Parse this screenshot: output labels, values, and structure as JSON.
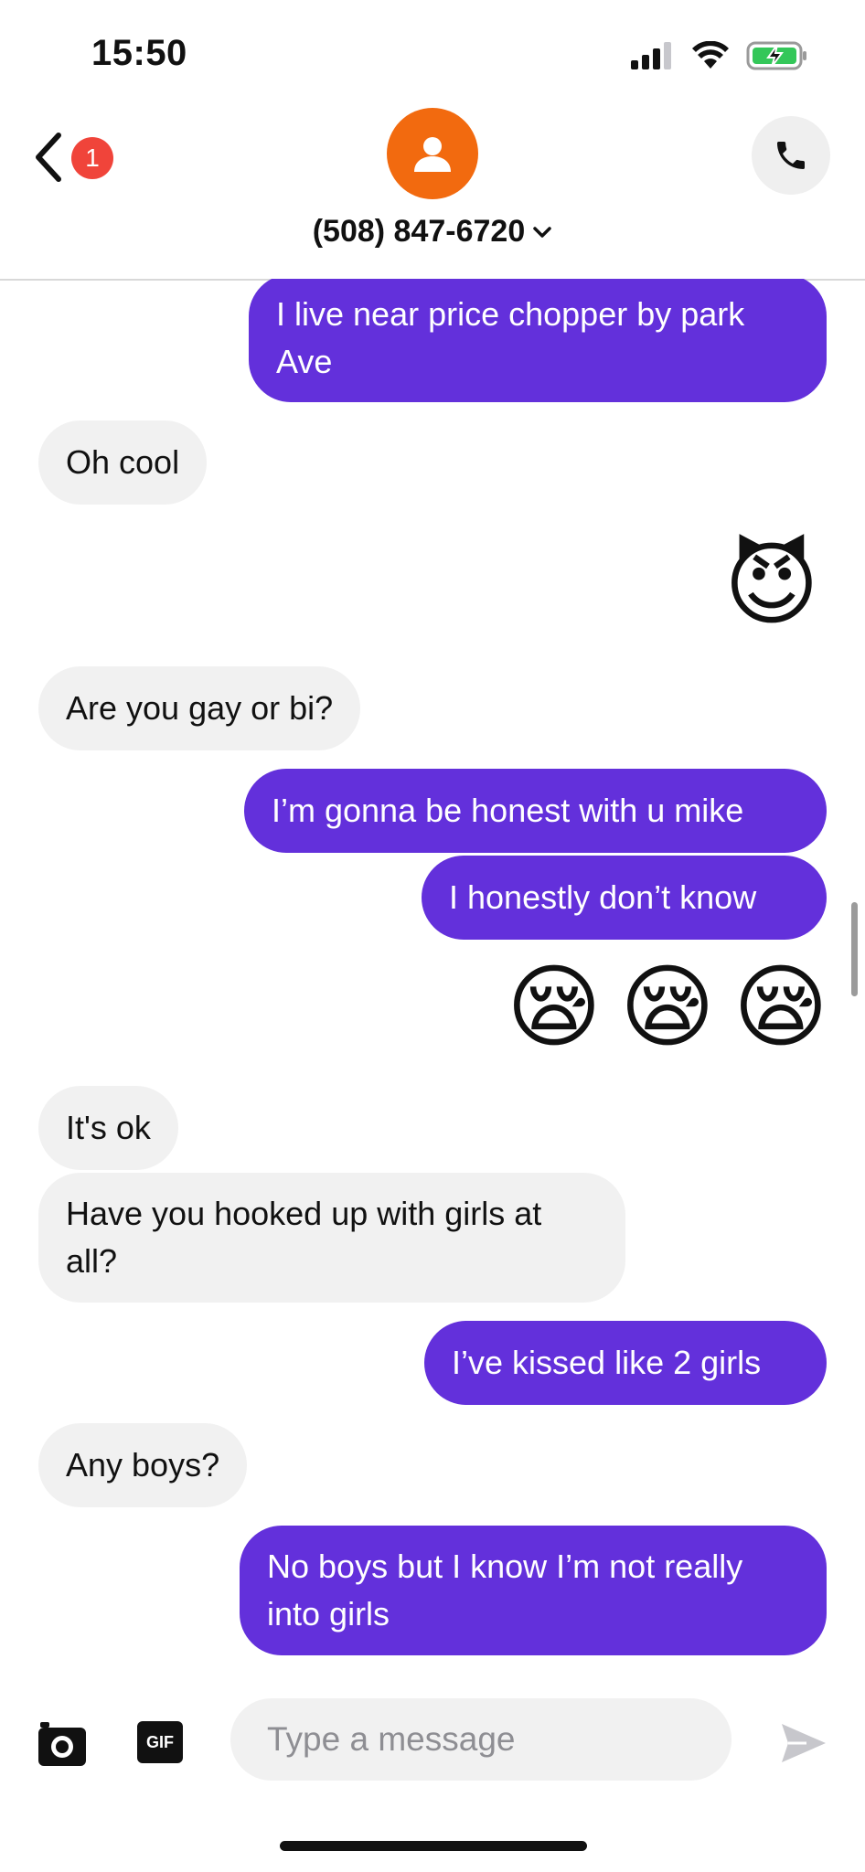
{
  "status_bar": {
    "time": "15:50"
  },
  "header": {
    "unread_count": "1",
    "contact_name": "(508) 847-6720",
    "colors": {
      "avatar": "#f26a0f",
      "badge": "#f0443a"
    }
  },
  "messages": [
    {
      "direction": "outgoing",
      "text": "I live near price chopper by park Ave"
    },
    {
      "direction": "incoming",
      "text": "Oh cool"
    },
    {
      "direction": "outgoing",
      "type": "emoji",
      "text": "😈"
    },
    {
      "direction": "incoming",
      "text": "Are you gay or bi?"
    },
    {
      "direction": "outgoing",
      "text": "I’m gonna be honest with u mike"
    },
    {
      "direction": "outgoing",
      "text": "I honestly don’t know"
    },
    {
      "direction": "outgoing",
      "type": "emoji",
      "text": "😪 😪 😪"
    },
    {
      "direction": "incoming",
      "text": "It's ok"
    },
    {
      "direction": "incoming",
      "text": "Have you hooked up with girls at all?"
    },
    {
      "direction": "outgoing",
      "text": "I’ve kissed like 2 girls"
    },
    {
      "direction": "incoming",
      "text": "Any boys?"
    },
    {
      "direction": "outgoing",
      "text": "No boys but I know I’m not really into girls"
    }
  ],
  "composer": {
    "placeholder": "Type a message",
    "gif_label": "GIF"
  },
  "colors": {
    "outgoing_bubble": "#6330db",
    "incoming_bubble": "#f1f1f1"
  }
}
